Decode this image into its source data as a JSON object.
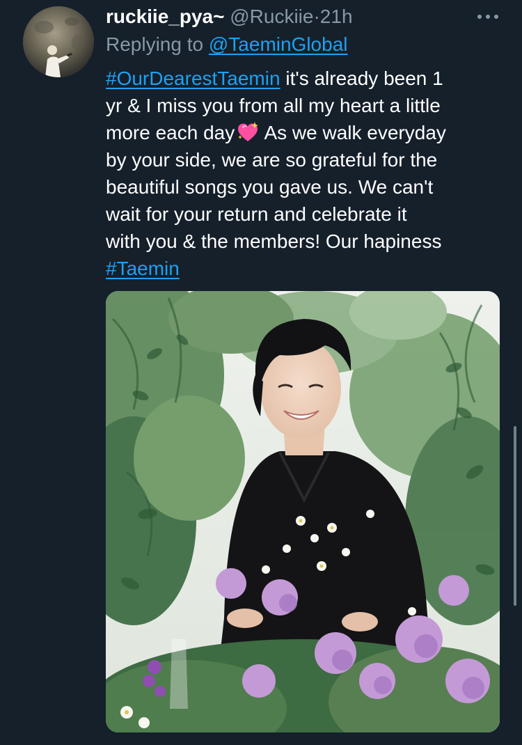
{
  "tweet": {
    "display_name": "ruckiie_pya~",
    "handle": "@Ruckiie",
    "separator": "·",
    "time": "21h",
    "more_icon": "more-dots-icon",
    "replying_prefix": "Replying to",
    "replying_to": "@TaeminGlobal",
    "body": {
      "hashtag_1": "#OurDearestTaemin",
      "line1_rest": " it's already been 1",
      "line2": "yr & I miss you from all my heart a little",
      "line3_a": "more each day",
      "line3_emoji": "sparkling-heart-icon",
      "line3_b": " As we walk everyday",
      "line4": "by your side, we are so grateful for the",
      "line5": "beautiful songs you gave us. We can't",
      "line6": "wait for your return and celebrate it",
      "line7": "with you  & the members! Our hapiness",
      "hashtag_2": "#Taemin"
    }
  },
  "colors": {
    "background": "#15202b",
    "text": "#ffffff",
    "secondary": "#8899a6",
    "link": "#1da1f2"
  }
}
